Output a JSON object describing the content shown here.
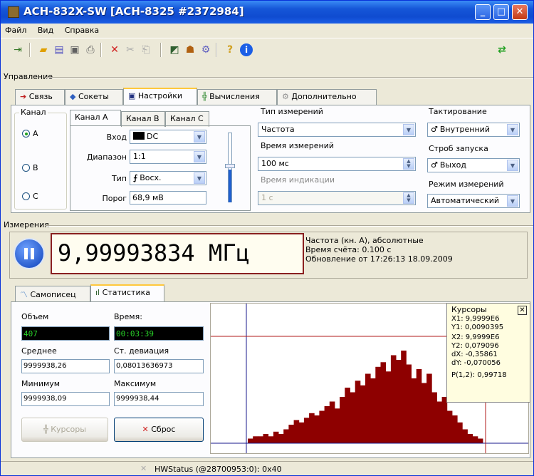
{
  "window": {
    "title": "АСН-832X-SW [АСН-8325 #2372984]"
  },
  "menu": {
    "file": "Файл",
    "view": "Вид",
    "help": "Справка"
  },
  "toolbar": {
    "help_icon_text": "?",
    "info_icon_text": "i"
  },
  "control": {
    "label": "Управление",
    "tabs": [
      "Связь",
      "Сокеты",
      "Настройки",
      "Вычисления",
      "Дополнительно"
    ],
    "channel": {
      "label": "Канал",
      "options": [
        "A",
        "B",
        "C"
      ],
      "selected": "A"
    },
    "channel_tabs": [
      "Канал A",
      "Канал B",
      "Канал C"
    ],
    "input": {
      "label": "Вход",
      "value": "DC"
    },
    "range": {
      "label": "Диапазон",
      "value": "1:1"
    },
    "type": {
      "label": "Тип",
      "value": "Восх."
    },
    "threshold": {
      "label": "Порог",
      "value": "68,9 мВ"
    },
    "meas_type": {
      "label": "Тип измерений",
      "value": "Частота"
    },
    "meas_time": {
      "label": "Время измерений",
      "value": "100 мс"
    },
    "ind_time": {
      "label": "Время индикации",
      "value": "1 с"
    },
    "clock": {
      "label": "Тактирование",
      "value": "Внутренний"
    },
    "strobe": {
      "label": "Строб запуска",
      "value": "Выход"
    },
    "mode": {
      "label": "Режим измерений",
      "value": "Автоматический"
    }
  },
  "measurements": {
    "label": "Измерения",
    "reading": "9,99993834 МГц",
    "info1": "Частота (кн. А), абсолютные",
    "info2": "Время счёта: 0.100 с",
    "info3": "Обновление от 17:26:13 18.09.2009"
  },
  "bottom_tabs": [
    "Самописец",
    "Статистика"
  ],
  "stats": {
    "volume_label": "Объем",
    "volume": "407",
    "time_label": "Время:",
    "time": "00:03:39",
    "mean_label": "Среднее",
    "mean": "9999938,26",
    "std_label": "Ст. девиация",
    "std": "0,08013636973",
    "min_label": "Минимум",
    "min": "9999938,09",
    "max_label": "Максимум",
    "max": "9999938,44",
    "cursors_button": "Курсоры",
    "reset_button": "Сброс"
  },
  "cursors": {
    "title": "Курсоры",
    "lines": [
      "X1: 9,9999E6",
      "Y1: 0,0090395",
      "X2: 9,9999E6",
      "Y2: 0,079096",
      "dX: -0,35861",
      "dY: -0,070056",
      "P(1,2): 0,99718"
    ]
  },
  "histogram": {
    "values": [
      2,
      3,
      3,
      4,
      3,
      5,
      4,
      6,
      8,
      10,
      9,
      11,
      13,
      12,
      14,
      16,
      18,
      15,
      20,
      24,
      22,
      27,
      25,
      30,
      28,
      33,
      35,
      31,
      38,
      36,
      40,
      34,
      28,
      32,
      26,
      30,
      22,
      18,
      20,
      14,
      12,
      9,
      6,
      4,
      3,
      2
    ]
  },
  "status": {
    "text": "HWStatus (@28700953:0): 0x40"
  },
  "colors": {
    "bar": "#8e0000",
    "cursor_vertical": "#1a1a8e",
    "cursor_horizontal": "#b01818"
  }
}
